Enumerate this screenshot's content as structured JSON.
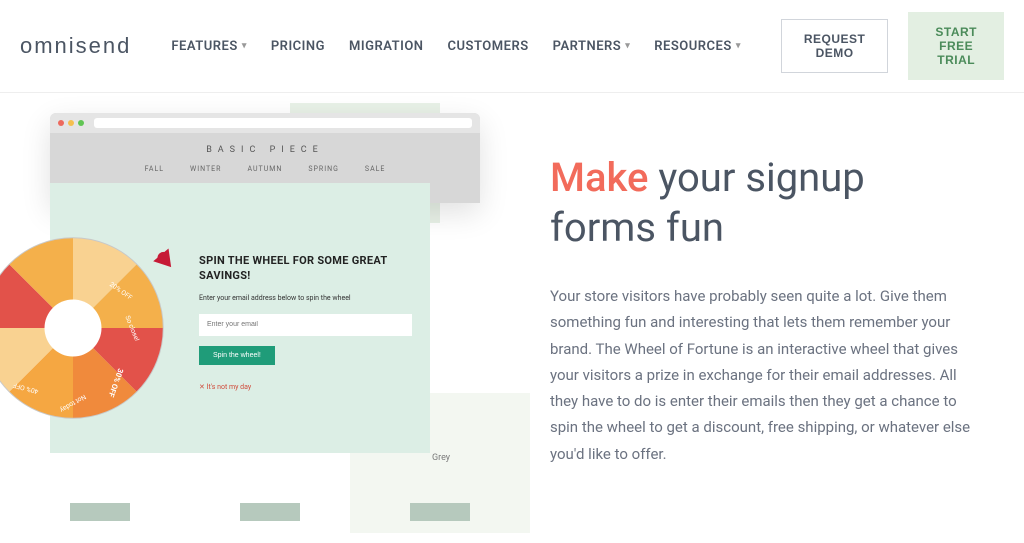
{
  "header": {
    "logo": "omnisend",
    "nav": {
      "features": "FEATURES",
      "pricing": "PRICING",
      "migration": "MIGRATION",
      "customers": "CUSTOMERS",
      "partners": "PARTNERS",
      "resources": "RESOURCES"
    },
    "request_demo": "REQUEST DEMO",
    "start_trial": "START FREE TRIAL"
  },
  "mock": {
    "brand": "BASIC PIECE",
    "cats": {
      "fall": "FALL",
      "winter": "WINTER",
      "autumn": "AUTUMN",
      "spring": "SPRING",
      "sale": "SALE"
    },
    "popup": {
      "title": "SPIN THE WHEEL FOR SOME GREAT SAVINGS!",
      "sub": "Enter your email address below to spin the wheel",
      "placeholder": "Enter your email",
      "cta": "Spin the wheel!",
      "skip": "✕ It's not my day"
    },
    "wheel": {
      "seg1": "20% OFF",
      "seg2": "So close!",
      "seg3": "30% OFF",
      "seg4": "Not today",
      "seg5": "40% OFF"
    },
    "grey": "Grey"
  },
  "hero": {
    "accent": "Make",
    "rest": " your signup forms fun",
    "para": "Your store visitors have probably seen quite a lot. Give them something fun and interesting that lets them remember your brand. The Wheel of Fortune is an interactive wheel that gives your visitors a prize in exchange for their email addresses. All they have to do is enter their emails then they get a chance to spin the wheel to get a discount, free shipping, or whatever else you'd like to offer."
  }
}
